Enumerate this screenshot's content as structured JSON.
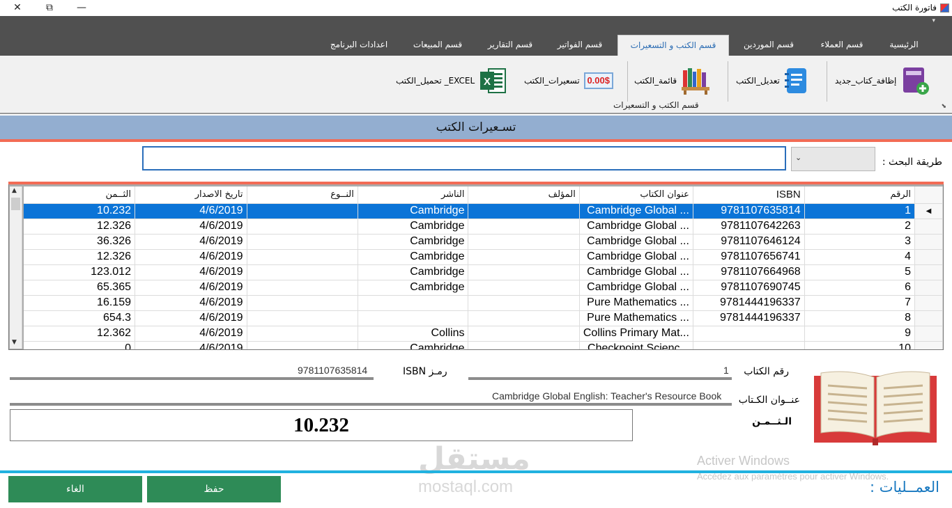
{
  "window": {
    "title": "فاتورة الكتب",
    "controls": {
      "close": "✕",
      "restore": "⧉",
      "minimize": "—"
    }
  },
  "tabs": [
    {
      "label": "الرئيسية",
      "active": false
    },
    {
      "label": "قسم العملاء",
      "active": false
    },
    {
      "label": "قسم الموردين",
      "active": false
    },
    {
      "label": "قسم الكتب و التسعيرات",
      "active": true
    },
    {
      "label": "قسم الفواتير",
      "active": false
    },
    {
      "label": "قسم التقارير",
      "active": false
    },
    {
      "label": "قسم المبيعات",
      "active": false
    },
    {
      "label": "اعدادات البرنامج",
      "active": false
    }
  ],
  "ribbon": {
    "buttons": [
      {
        "label": "إظافة_كتاب_جديد",
        "icon": "add-book-icon"
      },
      {
        "label": "تعديل_الكتب",
        "icon": "notebook-icon"
      },
      {
        "label": "قائمة_الكتب",
        "icon": "bookshelf-icon"
      },
      {
        "label": "تسعيرات_الكتب",
        "icon": "price-icon",
        "icon_text": "0.00$"
      },
      {
        "label": "EXCEL_ تحميل_الكتب",
        "icon": "excel-icon"
      }
    ],
    "group_label": "قسم الكتب و التسعيرات"
  },
  "section_title": "تسـعيرات الكتب",
  "search": {
    "label": "طريقة البحث :",
    "combo_value": "",
    "input_value": ""
  },
  "grid": {
    "columns": [
      "الرقم",
      "ISBN",
      "عنوان الكتاب",
      "المؤلف",
      "الناشر",
      "النــوع",
      "تاريخ الاصدار",
      "الثــمن"
    ],
    "selected_row": 0,
    "rows": [
      [
        "1",
        "9781107635814",
        "Cambridge Global ...",
        "",
        "Cambridge",
        "",
        "4/6/2019",
        "10.232"
      ],
      [
        "2",
        "9781107642263",
        "Cambridge Global ...",
        "",
        "Cambridge",
        "",
        "4/6/2019",
        "12.326"
      ],
      [
        "3",
        "9781107646124",
        "Cambridge Global ...",
        "",
        "Cambridge",
        "",
        "4/6/2019",
        "36.326"
      ],
      [
        "4",
        "9781107656741",
        "Cambridge Global ...",
        "",
        "Cambridge",
        "",
        "4/6/2019",
        "12.326"
      ],
      [
        "5",
        "9781107664968",
        "Cambridge Global ...",
        "",
        "Cambridge",
        "",
        "4/6/2019",
        "123.012"
      ],
      [
        "6",
        "9781107690745",
        "Cambridge Global ...",
        "",
        "Cambridge",
        "",
        "4/6/2019",
        "65.365"
      ],
      [
        "7",
        "9781444196337",
        "Pure Mathematics ...",
        "",
        "",
        "",
        "4/6/2019",
        "16.159"
      ],
      [
        "8",
        "9781444196337",
        "Pure Mathematics ...",
        "",
        "",
        "",
        "4/6/2019",
        "654.3"
      ],
      [
        "9",
        "",
        "Collins Primary Mat...",
        "",
        "Collins",
        "",
        "4/6/2019",
        "12.362"
      ],
      [
        "10",
        "",
        "Checkpoint Scienc...",
        "",
        "Cambridge",
        "",
        "4/6/2019",
        "0"
      ]
    ]
  },
  "form": {
    "book_number_label": "رقم الكتاب",
    "book_number_value": "1",
    "isbn_label": "رمـز ISBN",
    "isbn_value": "9781107635814",
    "title_label": "عنــوان الكـتاب",
    "title_value": "Cambridge Global English: Teacher's Resource Book",
    "price_label": "الـثــمـن",
    "price_value": "10.232"
  },
  "bottom": {
    "ops_label": "العمــليات :",
    "save_label": "حفظ",
    "cancel_label": "الغاء"
  },
  "overlay": {
    "activate_title": "Activer Windows",
    "activate_sub": "Accédez aux paramètres pour activer Windows.",
    "watermark_ar": "مستقل",
    "watermark_en": "mostaql.com"
  },
  "colors": {
    "tab_bar": "#505050",
    "section_band": "#93aed0",
    "accent_red": "#f26b55",
    "selection": "#0b74d7",
    "button_green": "#2e8b57",
    "cyan_line": "#21b2e0",
    "ops_blue": "#1878c0"
  }
}
